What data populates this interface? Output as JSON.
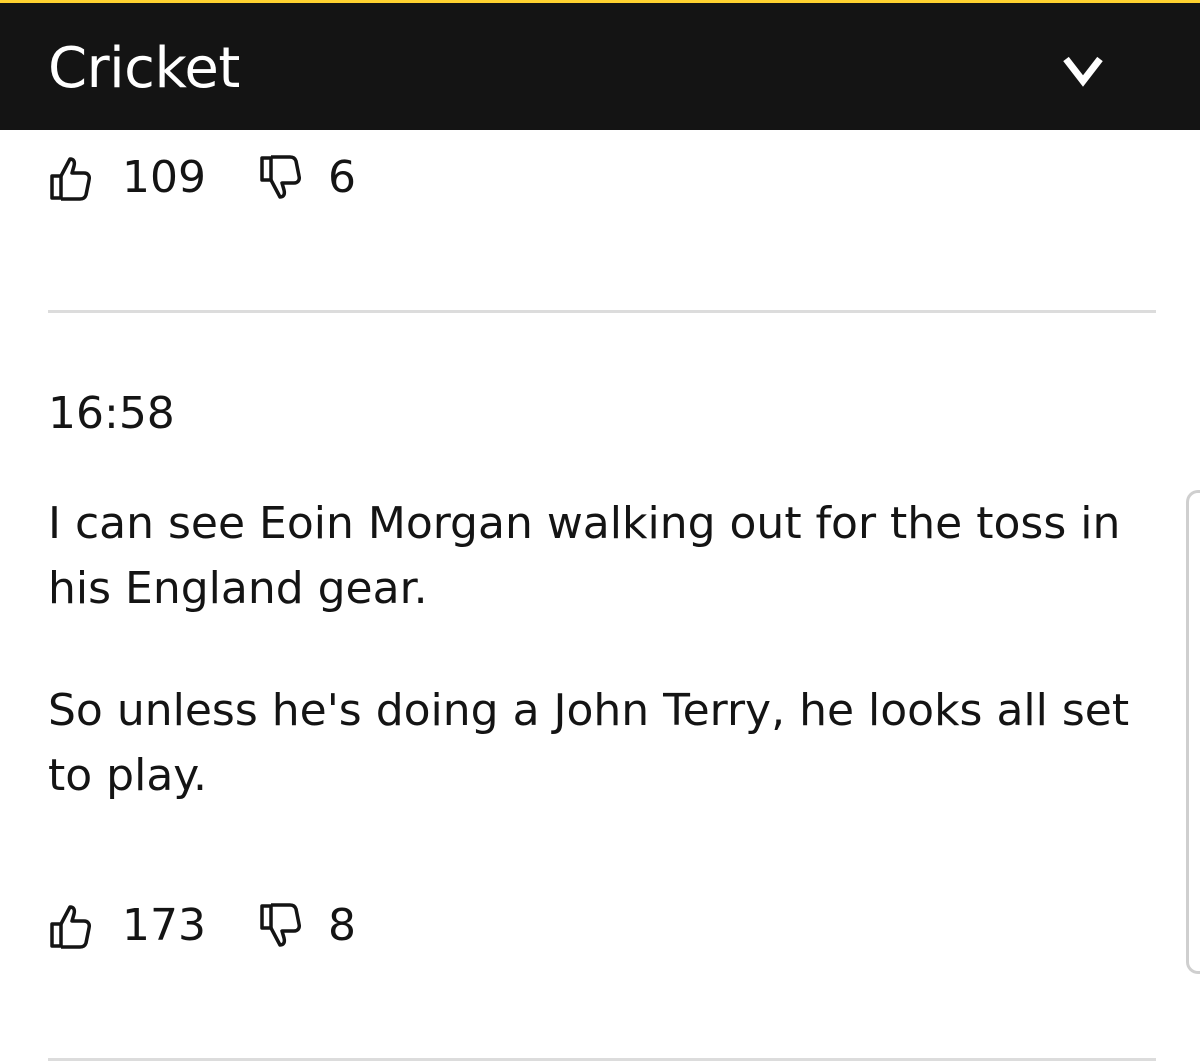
{
  "header": {
    "title": "Cricket",
    "menu_icon": "chevron-down-icon",
    "background": "#141414",
    "accent": "#ffd230"
  },
  "posts": [
    {
      "timestamp": "",
      "paragraphs": [],
      "likes": "109",
      "dislikes": "6"
    },
    {
      "timestamp": "16:58",
      "paragraphs": [
        "I can see Eoin Morgan walking out for the toss in his England gear.",
        "So unless he's doing a John Terry, he looks all set to play."
      ],
      "likes": "173",
      "dislikes": "8"
    }
  ],
  "icons": {
    "like": "thumbs-up-icon",
    "dislike": "thumbs-down-icon"
  }
}
